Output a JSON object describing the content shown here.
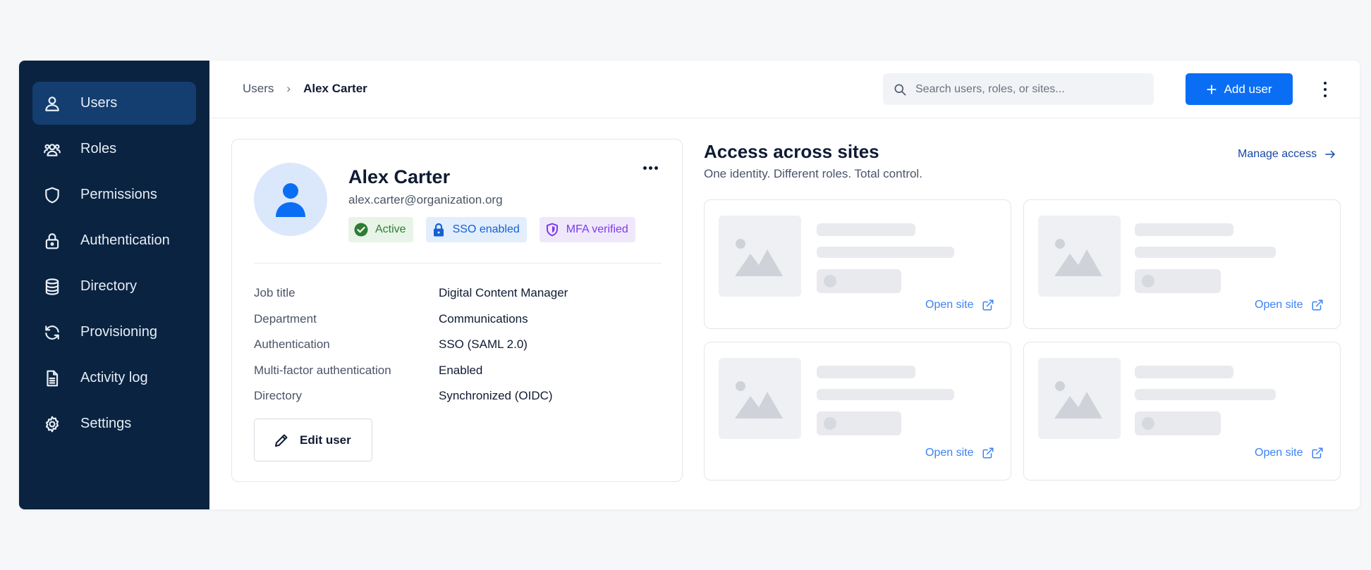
{
  "sidebar": {
    "items": [
      {
        "label": "Users",
        "icon": "user-icon",
        "active": true
      },
      {
        "label": "Roles",
        "icon": "users-group-icon"
      },
      {
        "label": "Permissions",
        "icon": "shield-icon"
      },
      {
        "label": "Authentication",
        "icon": "lock-icon"
      },
      {
        "label": "Directory",
        "icon": "database-icon"
      },
      {
        "label": "Provisioning",
        "icon": "sync-icon"
      },
      {
        "label": "Activity log",
        "icon": "document-icon"
      },
      {
        "label": "Settings",
        "icon": "gear-icon"
      }
    ]
  },
  "header": {
    "breadcrumb": {
      "parent": "Users",
      "current": "Alex Carter"
    },
    "search": {
      "placeholder": "Search users, roles, or sites..."
    },
    "add_user_label": "Add user"
  },
  "profile": {
    "name": "Alex Carter",
    "email": "alex.carter@organization.org",
    "badges": [
      {
        "label": "Active",
        "color": "#2e7d32"
      },
      {
        "label": "SSO enabled",
        "color": "#1560d4"
      },
      {
        "label": "MFA verified",
        "color": "#7c3aed"
      }
    ],
    "details": [
      {
        "label": "Job title",
        "value": "Digital Content Manager"
      },
      {
        "label": "Department",
        "value": "Communications"
      },
      {
        "label": "Authentication",
        "value": "SSO (SAML 2.0)"
      },
      {
        "label": "Multi-factor authentication",
        "value": "Enabled"
      },
      {
        "label": "Directory",
        "value": "Synchronized (OIDC)"
      }
    ],
    "edit_label": "Edit user"
  },
  "access": {
    "title": "Access across sites",
    "subtitle": "One identity. Different roles. Total control.",
    "manage_label": "Manage access",
    "sites": [
      {
        "open_label": "Open site"
      },
      {
        "open_label": "Open site"
      },
      {
        "open_label": "Open site"
      },
      {
        "open_label": "Open site"
      }
    ]
  },
  "colors": {
    "sidebar_bg": "#0a2340",
    "sidebar_active": "#143e6f",
    "primary": "#0a6ef5",
    "link": "#3b82f6"
  }
}
